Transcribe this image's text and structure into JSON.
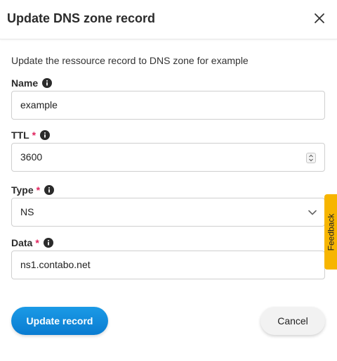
{
  "dialog": {
    "title": "Update DNS zone record",
    "description": "Update the ressource record to DNS zone for example"
  },
  "fields": {
    "name": {
      "label": "Name",
      "value": "example",
      "required": false
    },
    "ttl": {
      "label": "TTL",
      "value": "3600",
      "required": true
    },
    "type": {
      "label": "Type",
      "value": "NS",
      "required": true
    },
    "data": {
      "label": "Data",
      "value": "ns1.contabo.net",
      "required": true
    }
  },
  "required_marker": "*",
  "actions": {
    "submit_label": "Update record",
    "cancel_label": "Cancel"
  },
  "feedback": {
    "label": "Feedback"
  },
  "colors": {
    "primary": "#0a7cd1",
    "required": "#e0245e",
    "feedback": "#f7b500"
  },
  "icons": [
    "close-icon",
    "info-icon",
    "stepper-icon",
    "chevron-down-icon"
  ]
}
